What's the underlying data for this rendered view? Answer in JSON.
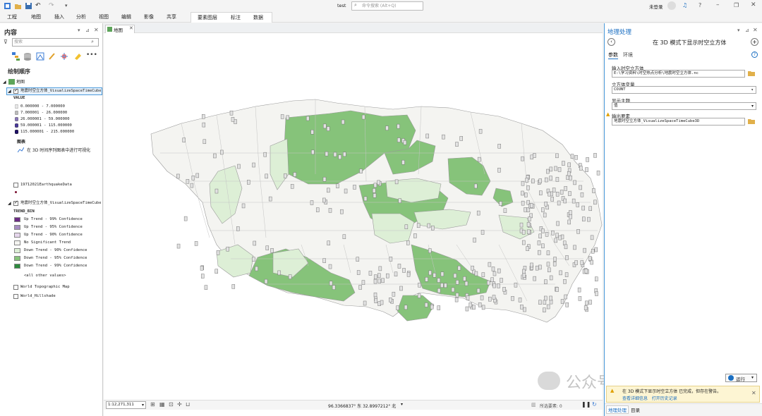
{
  "titlebar": {
    "project_name": "test",
    "search_placeholder": "命令搜索 (Alt+Q)",
    "user_status": "未登录"
  },
  "menubar": {
    "items": [
      "工程",
      "地图",
      "插入",
      "分析",
      "视图",
      "编辑",
      "影像",
      "共享"
    ],
    "context_items": [
      "要素图层",
      "标注",
      "数据"
    ]
  },
  "contents": {
    "title": "内容",
    "search_placeholder": "搜索",
    "drawing_order": "绘制顺序",
    "map_name": "地图",
    "layer1": "地震时空立方体_VisualizeSpaceTimeCube",
    "layer1_field": "VALUE",
    "layer1_classes": [
      "0.000000 - 7.000000",
      "7.000001 - 26.000000",
      "26.000001 - 59.000000",
      "59.000001 - 115.000000",
      "115.000001 - 215.000000"
    ],
    "chart_header": "图表",
    "chart_item": "在 3D 时间序列图表中进行可视化",
    "layer2": "19712021EarthquakeData",
    "layer3": "地震时空立方体_VisualizeSpaceTimeCube",
    "layer3_field": "TREND_BIN",
    "layer3_classes": [
      "Up Trend - 99% Confidence",
      "Up Trend - 95% Confidence",
      "Up Trend - 90% Confidence",
      "No Significant Trend",
      "Down Trend - 90% Confidence",
      "Down Trend - 95% Confidence",
      "Down Trend - 99% Confidence"
    ],
    "layer3_other": "<all other values>",
    "layer4": "World Topographic Map",
    "layer5": "World_Hillshade"
  },
  "colors": {
    "up99": "#6b2a84",
    "up95": "#a68cc0",
    "up90": "#e6d6ec",
    "nosig": "#f4f4f1",
    "down90": "#ddefd6",
    "down95": "#86c37a",
    "down99": "#2e8a3e",
    "accent": "#1b6fc2"
  },
  "map": {
    "tab_label": "地图",
    "scale": "1:12,271,311",
    "coords": "96.3366837° 东 32.8997212° 北",
    "selected_features": "所选要素: 0"
  },
  "geoprocessing": {
    "title": "地理处理",
    "tool_name": "在 3D 模式下显示时空立方体",
    "tabs": [
      "参数",
      "环境"
    ],
    "input_label": "输入时空立方体",
    "input_value": "E:\\学习资料\\时空热点分析\\地震时空立方体.nc",
    "variable_label": "立方体变量",
    "variable_value": "COUNT",
    "theme_label": "显示主题",
    "theme_value": "值",
    "output_label": "输出要素",
    "output_value": "地震时空立方体_VisualizeSpaceTimeCube3D",
    "run_label": "运行",
    "status_text": "在 3D 模式下显示时空立方体 已完成，但存在警告。",
    "status_links": "查看详细信息   打开历史记录",
    "bottom_tabs": [
      "地理处理",
      "目录"
    ]
  },
  "watermark": "公众号 · 凌晨GIS"
}
